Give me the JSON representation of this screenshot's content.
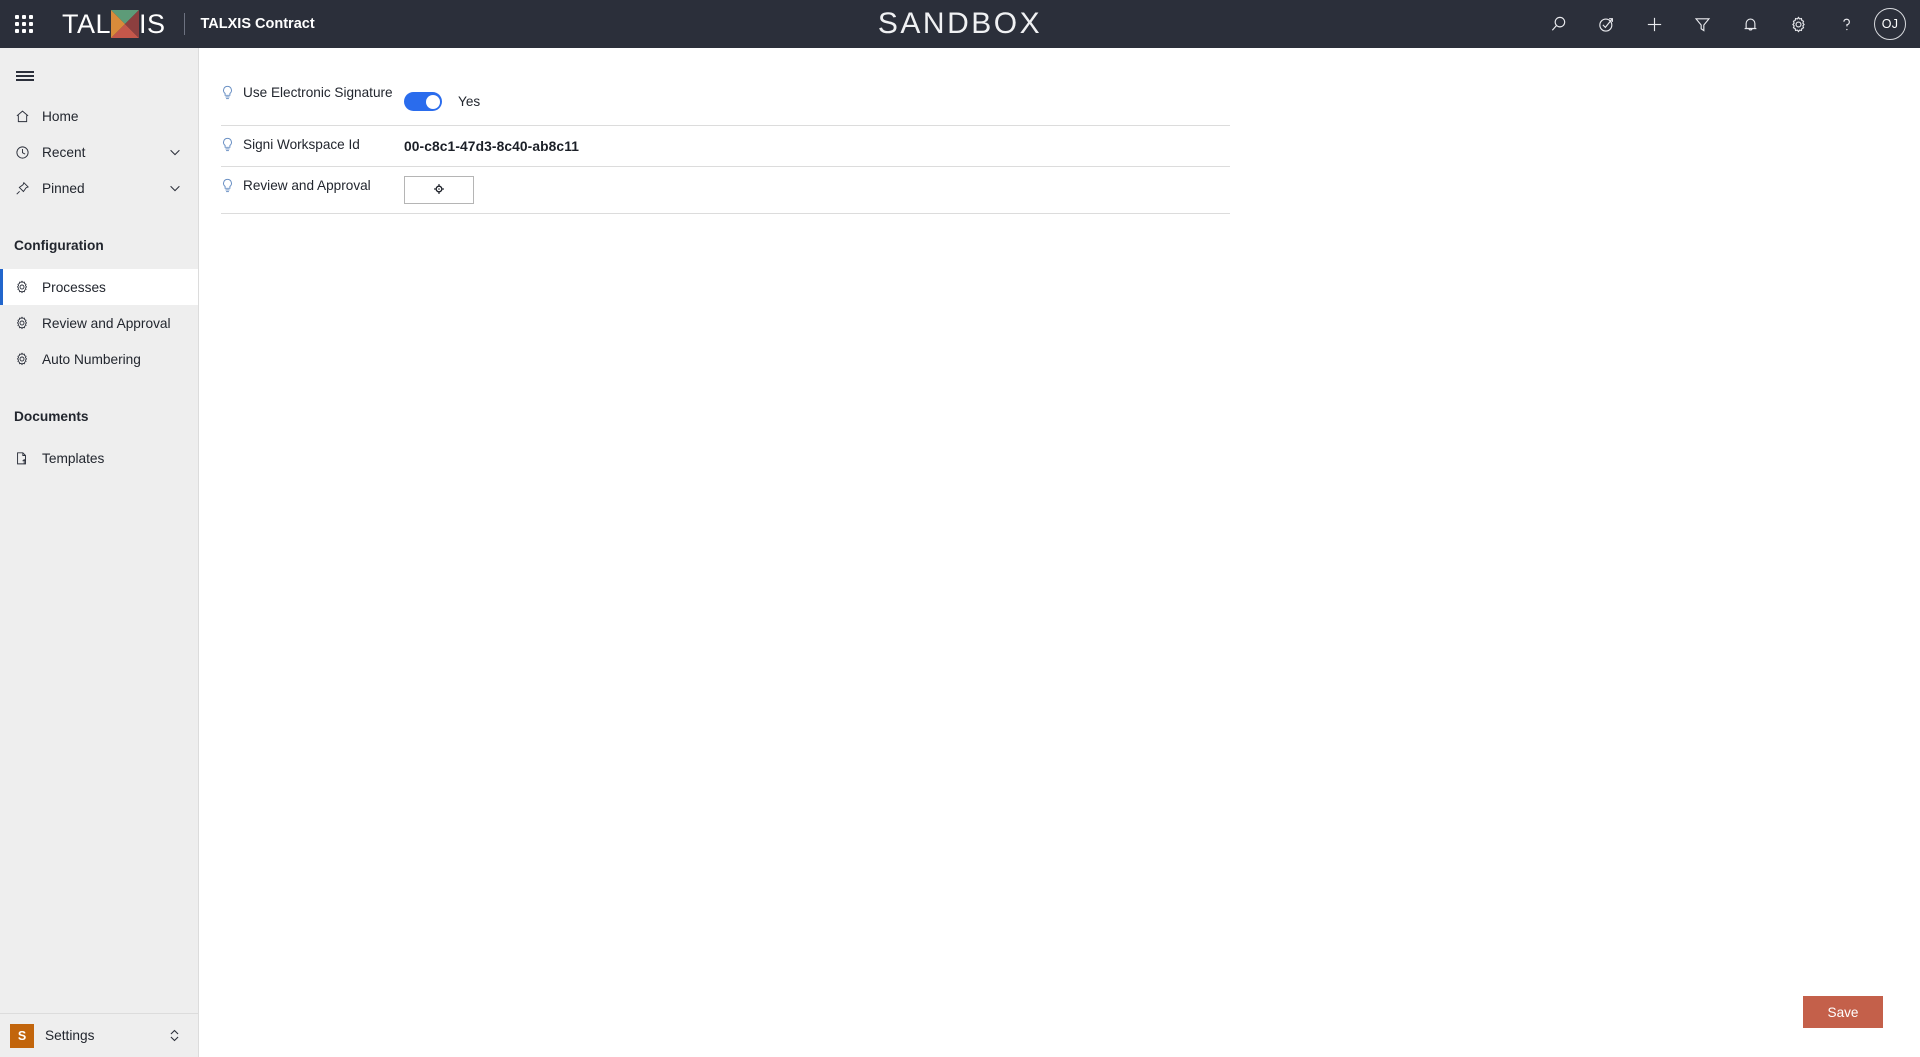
{
  "topbar": {
    "waffle_label": "app-launcher",
    "logo_part1": "TAL",
    "logo_part2": "IS",
    "app_name": "TALXIS Contract",
    "env_title": "SANDBOX",
    "icons": [
      {
        "name": "search-icon",
        "label": "Search"
      },
      {
        "name": "focus-check-icon",
        "label": "Focused view"
      },
      {
        "name": "plus-icon",
        "label": "Quick create"
      },
      {
        "name": "filter-icon",
        "label": "Filter"
      },
      {
        "name": "bell-icon",
        "label": "Notifications"
      },
      {
        "name": "gear-icon",
        "label": "Settings"
      },
      {
        "name": "help-icon",
        "label": "Help"
      }
    ],
    "avatar_initials": "OJ",
    "bar_color": "#2b2f3a"
  },
  "sidebar": {
    "hamburger_label": "Expand / collapse menu",
    "top_items": [
      {
        "label": "Home",
        "icon": "home-icon",
        "expandable": false
      },
      {
        "label": "Recent",
        "icon": "clock-icon",
        "expandable": true
      },
      {
        "label": "Pinned",
        "icon": "pin-icon",
        "expandable": true
      }
    ],
    "groups": [
      {
        "title": "Configuration",
        "items": [
          {
            "label": "Processes",
            "icon": "gear-icon",
            "selected": true
          },
          {
            "label": "Review and Approval",
            "icon": "gear-icon",
            "selected": false
          },
          {
            "label": "Auto Numbering",
            "icon": "gear-icon",
            "selected": false
          }
        ]
      },
      {
        "title": "Documents",
        "items": [
          {
            "label": "Templates",
            "icon": "document-upload-icon",
            "selected": false
          }
        ]
      }
    ],
    "footer": {
      "badge": "S",
      "label": "Settings",
      "badge_color": "#c2650c"
    },
    "selected_accent": "#2266cc",
    "background": "#eeeeee"
  },
  "main": {
    "form_rows": [
      {
        "label": "Use Electronic Signature",
        "type": "toggle",
        "toggle_state": "on",
        "toggle_text": "Yes",
        "toggle_color": "#2a6ced"
      },
      {
        "label": "Signi Workspace Id",
        "type": "text",
        "value": "00-c8c1-47d3-8c40-ab8c11"
      },
      {
        "label": "Review and Approval",
        "type": "lookup",
        "button_icon": "settings-target-icon",
        "value": ""
      }
    ],
    "save_label": "Save",
    "save_color": "#c4604a"
  }
}
